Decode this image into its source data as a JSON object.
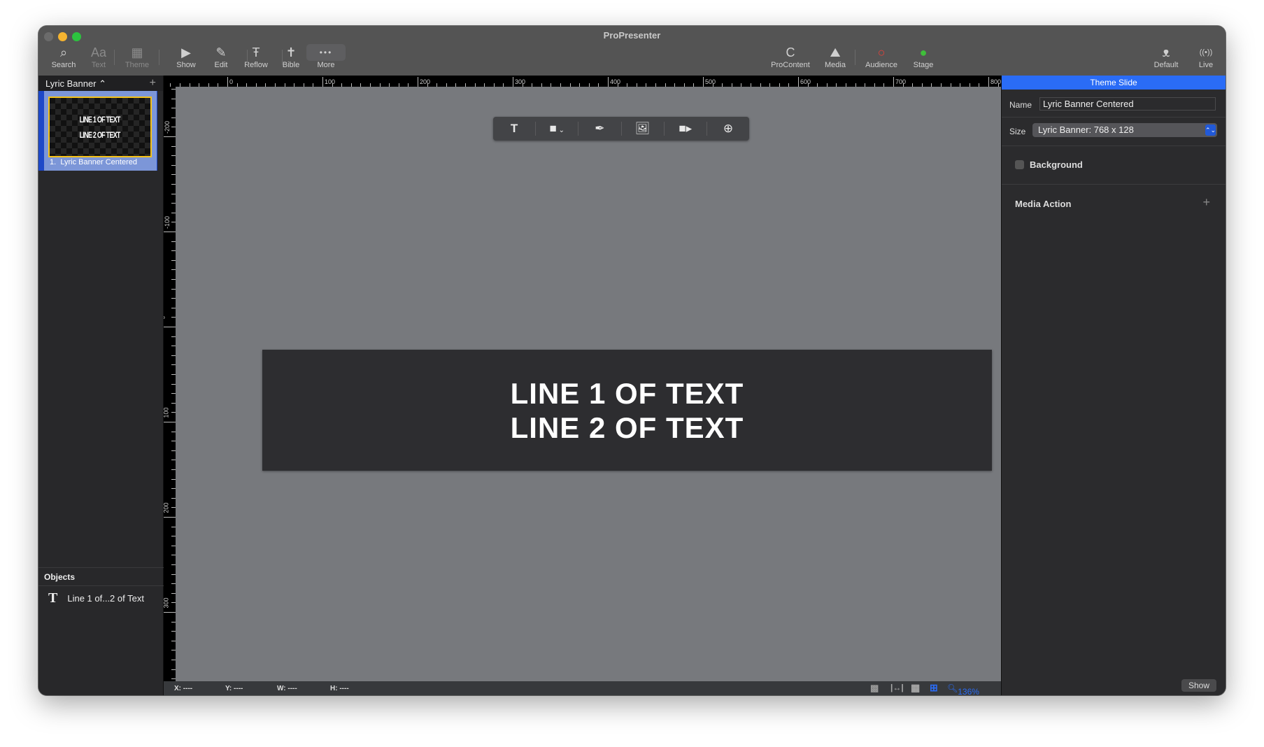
{
  "window": {
    "title": "ProPresenter"
  },
  "toolbar": {
    "left": [
      {
        "label": "Search",
        "icon": "search-icon",
        "glyph": "⌕"
      },
      {
        "label": "Text",
        "icon": "text-icon",
        "glyph": "Aa"
      },
      {
        "label": "Theme",
        "icon": "theme-icon",
        "glyph": "▦"
      },
      {
        "label": "Show",
        "icon": "play-icon",
        "glyph": "▶"
      },
      {
        "label": "Edit",
        "icon": "pencil-icon",
        "glyph": "✎"
      },
      {
        "label": "Reflow",
        "icon": "reflow-icon",
        "glyph": "Ŧ"
      },
      {
        "label": "Bible",
        "icon": "bible-icon",
        "glyph": "✝"
      },
      {
        "label": "More",
        "icon": "more-icon",
        "glyph": "•••"
      }
    ],
    "right": [
      {
        "label": "ProContent",
        "icon": "procontent-icon",
        "glyph": "C"
      },
      {
        "label": "Media",
        "icon": "media-icon",
        "glyph": "⛰"
      },
      {
        "label": "Audience",
        "icon": "audience-icon",
        "glyph": "○"
      },
      {
        "label": "Stage",
        "icon": "stage-icon",
        "glyph": "●"
      },
      {
        "label": "Default",
        "icon": "mustache-icon",
        "glyph": "ᴥ"
      },
      {
        "label": "Live",
        "icon": "live-broadcast-icon",
        "glyph": "((•))"
      }
    ],
    "colors": {
      "audience": "#e8403a",
      "stage": "#3fbf3a",
      "accent": "#2a6cf6",
      "selection_border": "#f4c21a"
    }
  },
  "left": {
    "library": "Lyric Banner ⌃",
    "slides": [
      {
        "number": "1.",
        "label": "Lyric Banner Centered",
        "lines": [
          "LINE 1 OF TEXT",
          "LINE 2 OF TEXT"
        ]
      }
    ],
    "objects_title": "Objects",
    "objects": [
      {
        "label": "Line 1 of...2 of Text",
        "icon": "text-object-icon"
      }
    ]
  },
  "rulers": {
    "horizontal": [
      "0",
      "100",
      "200",
      "300",
      "400",
      "500",
      "600",
      "700",
      "800"
    ],
    "vertical": [
      "-200",
      "-100",
      "0",
      "100",
      "200",
      "300"
    ]
  },
  "canvas": {
    "lines": [
      "LINE 1 OF TEXT",
      "LINE 2 OF TEXT"
    ],
    "tools": [
      "text-tool-icon",
      "shape-tool-icon",
      "pen-tool-icon",
      "image-tool-icon",
      "video-tool-icon",
      "web-tool-icon"
    ]
  },
  "status": {
    "x": "X: ----",
    "y": "Y: ----",
    "w": "W: ----",
    "h": "H: ----",
    "zoom": "136%"
  },
  "inspector": {
    "title": "Theme Slide",
    "name_label": "Name",
    "name_value": "Lyric Banner Centered",
    "size_label": "Size",
    "size_value": "Lyric Banner: 768 x 128",
    "background_label": "Background",
    "background_checked": false,
    "media_action_label": "Media Action",
    "show_button": "Show"
  }
}
